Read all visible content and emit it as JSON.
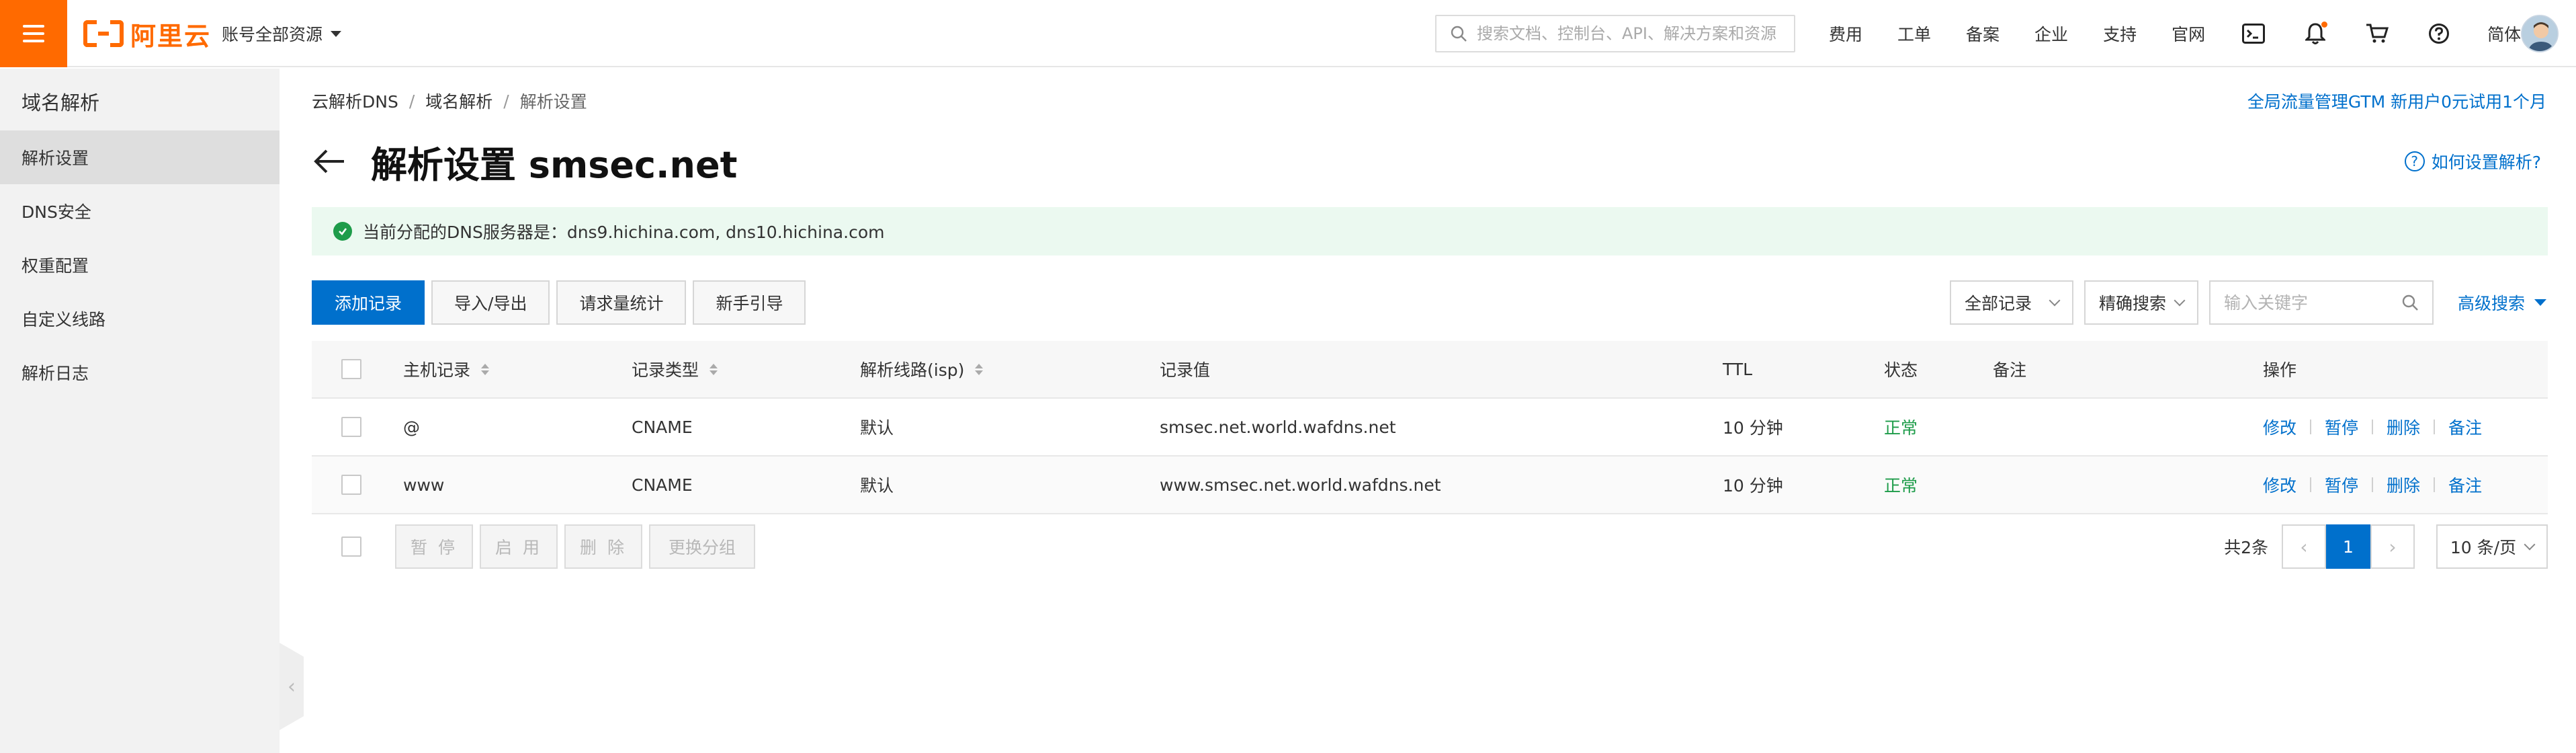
{
  "brand": {
    "logo_text": "阿里云",
    "accent": "#ff6a00",
    "link": "#0070cc"
  },
  "topbar": {
    "account_label": "账号全部资源",
    "search_placeholder": "搜索文档、控制台、API、解决方案和资源",
    "nav": [
      "费用",
      "工单",
      "备案",
      "企业",
      "支持",
      "官网"
    ],
    "lang": "简体",
    "icons": [
      "terminal-icon",
      "bell-icon",
      "cart-icon",
      "help-icon"
    ]
  },
  "sidebar": {
    "title": "域名解析",
    "items": [
      {
        "label": "解析设置",
        "active": true
      },
      {
        "label": "DNS安全"
      },
      {
        "label": "权重配置"
      },
      {
        "label": "自定义线路"
      },
      {
        "label": "解析日志"
      }
    ]
  },
  "breadcrumb": [
    "云解析DNS",
    "域名解析",
    "解析设置"
  ],
  "promo": "全局流量管理GTM 新用户0元试用1个月",
  "page": {
    "title": "解析设置 smsec.net",
    "help": "如何设置解析?"
  },
  "notice": "当前分配的DNS服务器是：dns9.hichina.com, dns10.hichina.com",
  "toolbar": {
    "add": "添加记录",
    "import_export": "导入/导出",
    "stats": "请求量统计",
    "guide": "新手引导"
  },
  "filters": {
    "record_filter": "全部记录",
    "match_mode": "精确搜索",
    "keyword_placeholder": "输入关键字",
    "advanced": "高级搜索"
  },
  "table": {
    "headers": {
      "host": "主机记录",
      "type": "记录类型",
      "line": "解析线路(isp)",
      "value": "记录值",
      "ttl": "TTL",
      "status": "状态",
      "remark": "备注",
      "actions": "操作"
    },
    "rows": [
      {
        "host": "@",
        "type": "CNAME",
        "line": "默认",
        "value": "smsec.net.world.wafdns.net",
        "ttl": "10 分钟",
        "status": "正常",
        "remark": ""
      },
      {
        "host": "www",
        "type": "CNAME",
        "line": "默认",
        "value": "www.smsec.net.world.wafdns.net",
        "ttl": "10 分钟",
        "status": "正常",
        "remark": ""
      }
    ],
    "row_actions": [
      "修改",
      "暂停",
      "删除",
      "备注"
    ]
  },
  "bulk": {
    "pause": "暂 停",
    "enable": "启 用",
    "delete": "删 除",
    "change_group": "更换分组"
  },
  "pagination": {
    "total": "共2条",
    "current": "1",
    "page_size": "10 条/页"
  }
}
